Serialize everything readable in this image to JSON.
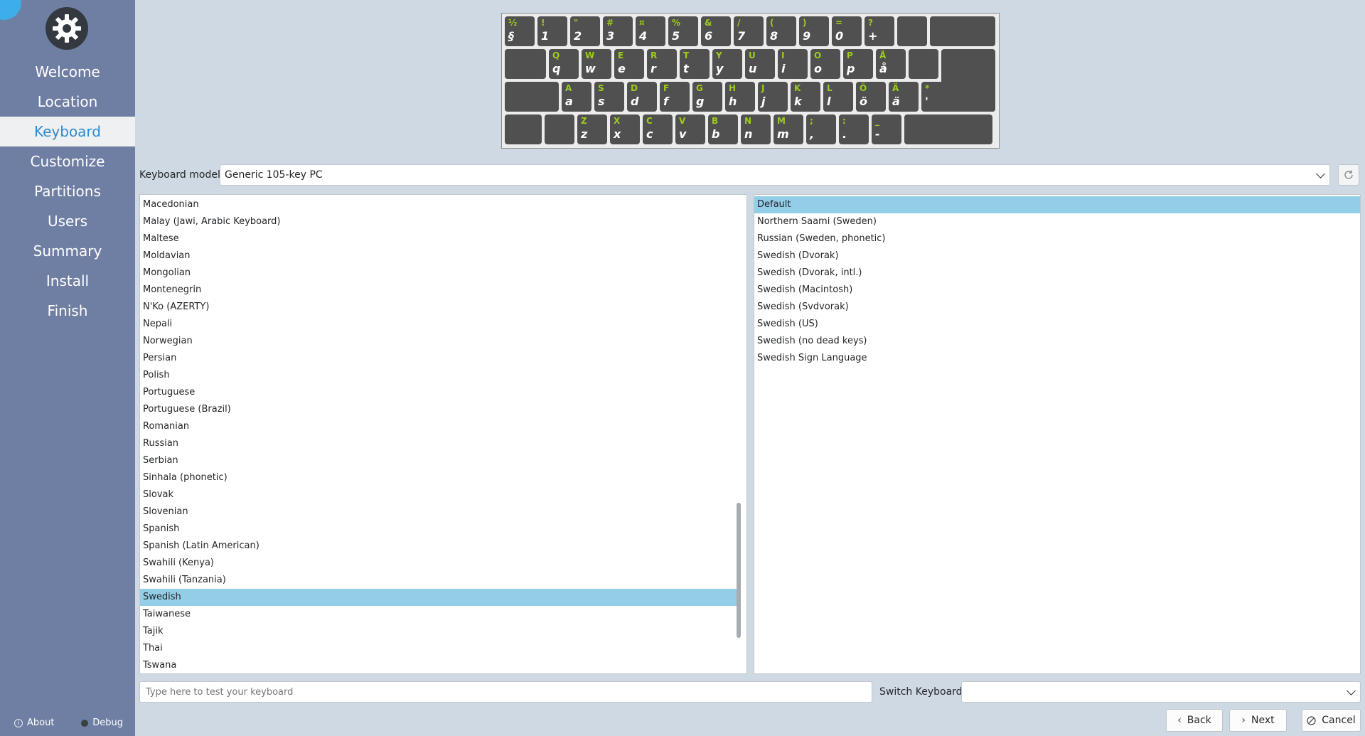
{
  "sidebar": {
    "items": [
      {
        "label": "Welcome"
      },
      {
        "label": "Location"
      },
      {
        "label": "Keyboard"
      },
      {
        "label": "Customize"
      },
      {
        "label": "Partitions"
      },
      {
        "label": "Users"
      },
      {
        "label": "Summary"
      },
      {
        "label": "Install"
      },
      {
        "label": "Finish"
      }
    ],
    "active_index": 2,
    "about_label": "About",
    "debug_label": "Debug"
  },
  "keyboard_preview": {
    "rows": [
      [
        {
          "up": "½",
          "low": "§"
        },
        {
          "up": "!",
          "low": "1"
        },
        {
          "up": "\"",
          "low": "2"
        },
        {
          "up": "#",
          "low": "3"
        },
        {
          "up": "¤",
          "low": "4"
        },
        {
          "up": "%",
          "low": "5"
        },
        {
          "up": "&",
          "low": "6"
        },
        {
          "up": "/",
          "low": "7"
        },
        {
          "up": "(",
          "low": "8"
        },
        {
          "up": ")",
          "low": "9"
        },
        {
          "up": "=",
          "low": "0"
        },
        {
          "up": "?",
          "low": "+"
        },
        {
          "up": "",
          "low": ""
        },
        {
          "up": "",
          "low": ""
        }
      ],
      [
        {
          "up": "",
          "low": ""
        },
        {
          "up": "Q",
          "low": "q"
        },
        {
          "up": "W",
          "low": "w"
        },
        {
          "up": "E",
          "low": "e"
        },
        {
          "up": "R",
          "low": "r"
        },
        {
          "up": "T",
          "low": "t"
        },
        {
          "up": "Y",
          "low": "y"
        },
        {
          "up": "U",
          "low": "u"
        },
        {
          "up": "I",
          "low": "i"
        },
        {
          "up": "O",
          "low": "o"
        },
        {
          "up": "P",
          "low": "p"
        },
        {
          "up": "Å",
          "low": "å"
        },
        {
          "up": "",
          "low": ""
        },
        {
          "up": "",
          "low": ""
        }
      ],
      [
        {
          "up": "",
          "low": ""
        },
        {
          "up": "A",
          "low": "a"
        },
        {
          "up": "S",
          "low": "s"
        },
        {
          "up": "D",
          "low": "d"
        },
        {
          "up": "F",
          "low": "f"
        },
        {
          "up": "G",
          "low": "g"
        },
        {
          "up": "H",
          "low": "h"
        },
        {
          "up": "J",
          "low": "j"
        },
        {
          "up": "K",
          "low": "k"
        },
        {
          "up": "L",
          "low": "l"
        },
        {
          "up": "Ö",
          "low": "ö"
        },
        {
          "up": "Ä",
          "low": "ä"
        },
        {
          "up": "*",
          "low": "'"
        },
        {
          "up": "",
          "low": ""
        }
      ],
      [
        {
          "up": "",
          "low": ""
        },
        {
          "up": "",
          "low": ""
        },
        {
          "up": "Z",
          "low": "z"
        },
        {
          "up": "X",
          "low": "x"
        },
        {
          "up": "C",
          "low": "c"
        },
        {
          "up": "V",
          "low": "v"
        },
        {
          "up": "B",
          "low": "b"
        },
        {
          "up": "N",
          "low": "n"
        },
        {
          "up": "M",
          "low": "m"
        },
        {
          "up": ";",
          "low": ","
        },
        {
          "up": ":",
          "low": "."
        },
        {
          "up": "_",
          "low": "-"
        },
        {
          "up": "",
          "low": ""
        }
      ]
    ]
  },
  "model": {
    "label": "Keyboard model:",
    "value": "Generic 105-key PC"
  },
  "layouts": [
    "Macedonian",
    "Malay (Jawi, Arabic Keyboard)",
    "Maltese",
    "Moldavian",
    "Mongolian",
    "Montenegrin",
    "N'Ko (AZERTY)",
    "Nepali",
    "Norwegian",
    "Persian",
    "Polish",
    "Portuguese",
    "Portuguese (Brazil)",
    "Romanian",
    "Russian",
    "Serbian",
    "Sinhala (phonetic)",
    "Slovak",
    "Slovenian",
    "Spanish",
    "Spanish (Latin American)",
    "Swahili (Kenya)",
    "Swahili (Tanzania)",
    "Swedish",
    "Taiwanese",
    "Tajik",
    "Thai",
    "Tswana"
  ],
  "layouts_selected": "Swedish",
  "variants": [
    "Default",
    "Northern Saami (Sweden)",
    "Russian (Sweden, phonetic)",
    "Swedish (Dvorak)",
    "Swedish (Dvorak, intl.)",
    "Swedish (Macintosh)",
    "Swedish (Svdvorak)",
    "Swedish (US)",
    "Swedish (no dead keys)",
    "Swedish Sign Language"
  ],
  "variants_selected": "Default",
  "test": {
    "placeholder": "Type here to test your keyboard"
  },
  "switch": {
    "label": "Switch Keyboard:",
    "value": ""
  },
  "buttons": {
    "back": "Back",
    "next": "Next",
    "cancel": "Cancel"
  },
  "colors": {
    "accent": "#2e8bd0",
    "selection": "#93cee9",
    "sidebar": "#6f7ea3",
    "key_shift_label": "#9ecc1c"
  }
}
